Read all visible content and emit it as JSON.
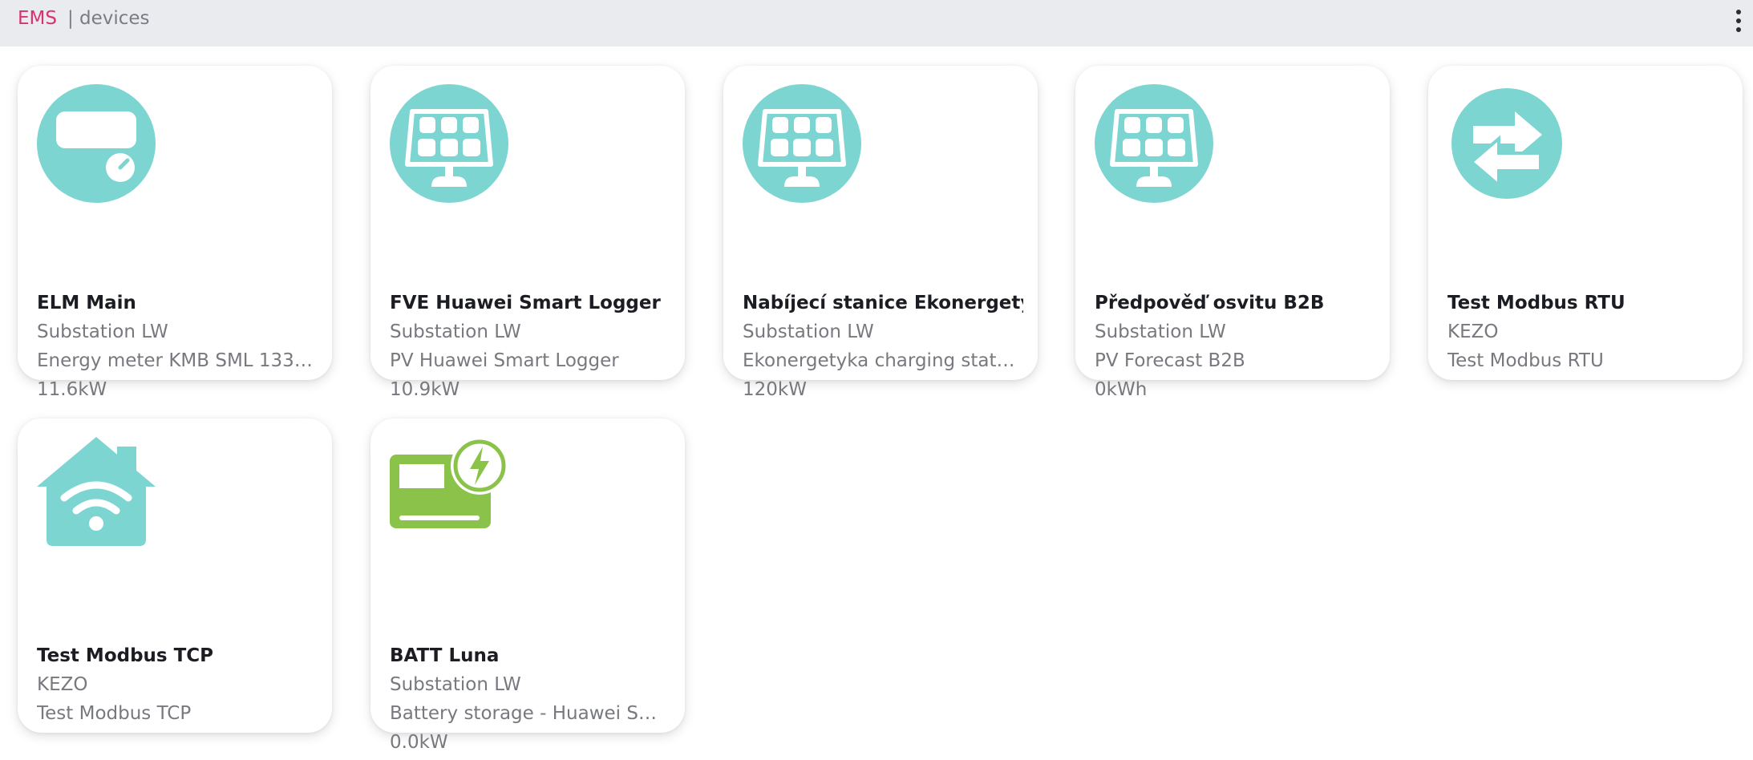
{
  "header": {
    "brand": "EMS",
    "separator": "|",
    "page": "devices",
    "menu_icon": "more-vertical-icon"
  },
  "colors": {
    "accent": "#d8336b",
    "icon_teal": "#7dd5d2",
    "icon_green": "#8bc34a",
    "header_bg": "#e9ebef"
  },
  "devices": [
    {
      "icon": "energy-meter-icon",
      "name": "ELM Main",
      "site": "Substation LW",
      "type": "Energy meter KMB SML 133 …",
      "value": "11.6kW"
    },
    {
      "icon": "solar-panel-icon",
      "name": "FVE Huawei Smart Logger",
      "site": "Substation LW",
      "type": "PV Huawei Smart Logger",
      "value": "10.9kW"
    },
    {
      "icon": "solar-panel-icon",
      "name": "Nabíjecí stanice Ekonergetyka",
      "site": "Substation LW",
      "type": "Ekonergetyka charging station",
      "value": "120kW"
    },
    {
      "icon": "solar-panel-icon",
      "name": "Předpověď osvitu B2B",
      "site": "Substation LW",
      "type": "PV Forecast B2B",
      "value": "0kWh"
    },
    {
      "icon": "exchange-arrows-icon",
      "name": "Test Modbus RTU",
      "site": "KEZO",
      "type": "Test Modbus RTU",
      "value": ""
    },
    {
      "icon": "smart-home-wifi-icon",
      "name": "Test Modbus TCP",
      "site": "KEZO",
      "type": "Test Modbus TCP",
      "value": ""
    },
    {
      "icon": "battery-charge-icon",
      "name": "BATT Luna",
      "site": "Substation LW",
      "type": "Battery storage - Huawei Sma…",
      "value": "0.0kW"
    }
  ]
}
